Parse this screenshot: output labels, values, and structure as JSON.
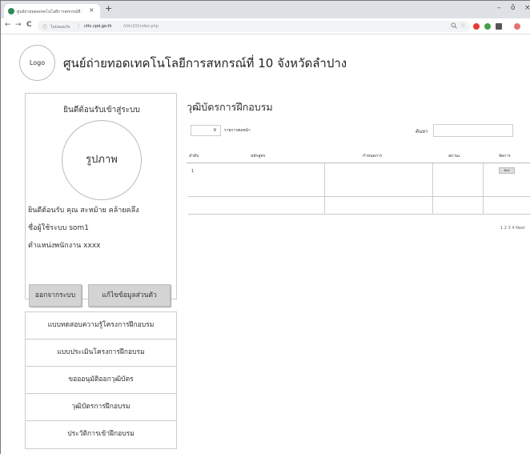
{
  "browser": {
    "tab_title": "ศูนย์ถ่ายทอดเทคโนโลยีการสหกรณ์ที่ 10",
    "tab_close": "×",
    "new_tab": "+",
    "window_controls": {
      "minimize": "–",
      "maximize": "ō",
      "close": "×"
    },
    "nav": {
      "back": "←",
      "forward": "→",
      "reload": "C"
    },
    "url_info_icon": "ⓘ",
    "url_site_label": "ไม่ปลอดภัย",
    "url_separator": "|",
    "url_domain": "cttc.cpd.go.th",
    "url_path": "/cttc10/index.php"
  },
  "header": {
    "logo": "Logo",
    "site_title": "ศูนย์ถ่ายทอดเทคโนโลยีการสหกรณ์ที่ 10 จังหวัดลำปาง"
  },
  "profile": {
    "welcome": "ยินดีต้อนรับเข้าสู่ระบบ",
    "photo": "รูปภาพ",
    "greeting": "ยินดีต้อนรับ คุณ สะหม้าย คล้ายคลึง",
    "username": "ชื่อผู้ใช้ระบบ som1",
    "position": "ตำแหน่งพนักงาน xxxx",
    "logout": "ออกจากระบบ",
    "edit_profile": "แก้ไขข้อมูลส่วนตัว"
  },
  "menu": {
    "items": [
      "แบบทดสอบความรู้โครงการฝึกอบรม",
      "แบบประเมินโครงการฝึกอบรม",
      "ขอออนุมัติออกวุฒิบัตร",
      "วุฒิบัตรการฝึกอบรม",
      "ประวัติการเข้าฝึกอบรม"
    ]
  },
  "main": {
    "title": "วุฒิบัตรการฝึกอบรม",
    "per_page_label": "รายการต่อหน้า",
    "search_label": "ค้นหา",
    "table": {
      "headers": [
        "ลำดับ",
        "หลักสูตร",
        "กำหนดการ",
        "สถานะ",
        "จัดการ"
      ],
      "rows": [
        {
          "no": "1",
          "course": "",
          "schedule": "",
          "status": "",
          "action": "พิมพ์"
        }
      ]
    },
    "pager": "1 2 3 4 Next"
  },
  "colors": {
    "tab_strip": "#dee1e6",
    "button_bg": "#d4d4d4",
    "border": "#cccccc"
  }
}
